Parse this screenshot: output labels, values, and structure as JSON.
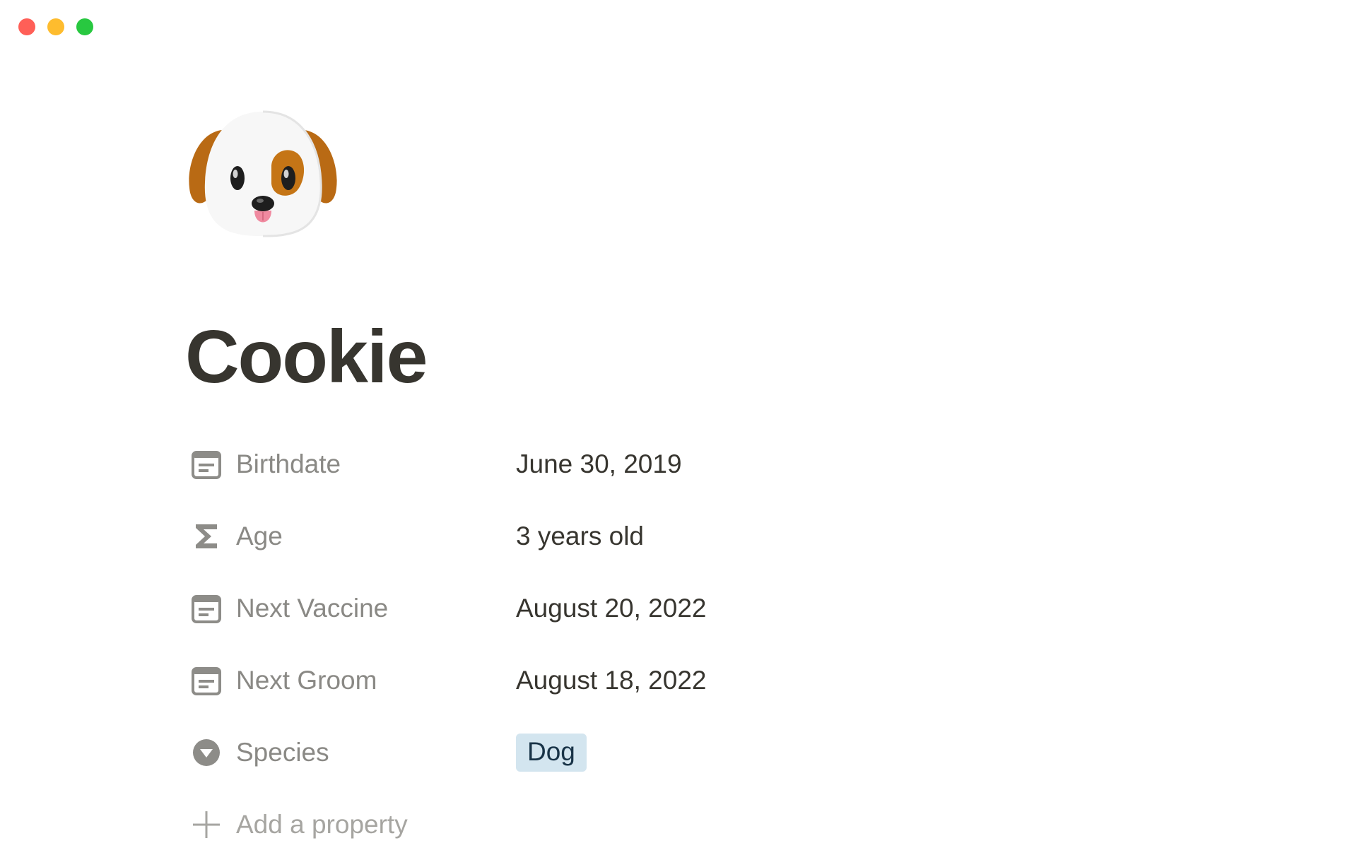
{
  "window": {
    "traffic_lights": {
      "close_color": "#ff5f57",
      "minimize_color": "#febc2e",
      "zoom_color": "#28c840"
    }
  },
  "page": {
    "icon": "dog-face-emoji",
    "title": "Cookie"
  },
  "properties": [
    {
      "icon": "calendar-icon",
      "name": "Birthdate",
      "value": "June 30, 2019"
    },
    {
      "icon": "sigma-icon",
      "name": "Age",
      "value": "3 years old"
    },
    {
      "icon": "calendar-icon",
      "name": "Next Vaccine",
      "value": "August 20, 2022"
    },
    {
      "icon": "calendar-icon",
      "name": "Next Groom",
      "value": "August 18, 2022"
    },
    {
      "icon": "select-icon",
      "name": "Species",
      "value": "Dog",
      "tag_color": "#d3e5ef",
      "tag_text_color": "#183347"
    }
  ],
  "add_property": {
    "icon": "plus-icon",
    "label": "Add a property"
  },
  "colors": {
    "title": "#37352f",
    "label": "#8a8985",
    "icon": "#8d8c88",
    "add_label": "#a6a5a1"
  }
}
